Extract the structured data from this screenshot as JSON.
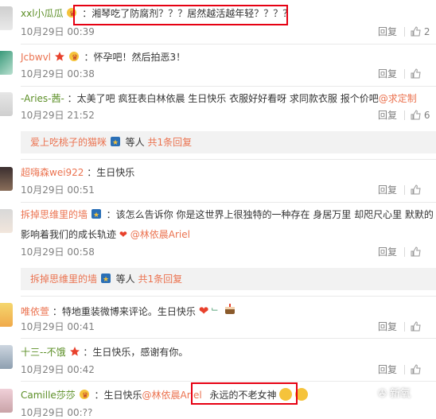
{
  "comments": [
    {
      "user": "xxl小瓜瓜",
      "text": "：湘琴吃了防腐剂？？？居然越活越年轻？？？？",
      "time": "10月29日 00:39",
      "reply": "回复",
      "likes": "2"
    },
    {
      "user": "Jcbwvl",
      "text": "：怀孕吧！然后拍恶3！",
      "time": "10月29日 00:38",
      "reply": "回复",
      "likes": ""
    },
    {
      "user": "-Aries-茜-",
      "text": "：太美了吧 疯狂表白林依晨 生日快乐 衣服好好看呀 求同款衣服 报个价吧",
      "mention": "@求定制",
      "time": "10月29日 21:52",
      "reply": "回复",
      "likes": "6"
    },
    {
      "user": "超嗨森wei922",
      "text": "：生日快乐",
      "time": "10月29日 00:51",
      "reply": "回复",
      "likes": ""
    },
    {
      "user": "拆掉思维里的墙",
      "text": "：该怎么告诉你 你是这世界上很独特的一种存在 身居万里 却咫尺心里  默默的",
      "text2": "影响着我们的成长轨迹",
      "mention": "@林依晨Ariel",
      "time": "10月29日 00:58",
      "reply": "回复",
      "likes": ""
    },
    {
      "user": "唯依萱",
      "text": "：特地重装微博来评论。生日快乐",
      "time": "10月29日 00:41",
      "reply": "回复",
      "likes": ""
    },
    {
      "user": "十三--不饿",
      "text": "：生日快乐，感谢有你。",
      "time": "10月29日 00:42",
      "reply": "回复",
      "likes": ""
    },
    {
      "user": "Camille莎莎",
      "text": "：生日快乐",
      "mention": "@林依晨Ariel",
      "text3": "永远的不老女神",
      "time": "10月29日 00:??",
      "reply": "回复",
      "likes": ""
    }
  ],
  "subreplies": [
    {
      "user": "爱上吃桃子的猫咪",
      "suffix": "等人",
      "count_text": "共1条回复"
    },
    {
      "user": "拆掉思维里的墙",
      "suffix": "等人",
      "count_text": "共1条回复"
    }
  ],
  "watermark": "新氧",
  "colors": {
    "username": "#eb7350",
    "highlight": "#e60012",
    "time": "#808080"
  }
}
